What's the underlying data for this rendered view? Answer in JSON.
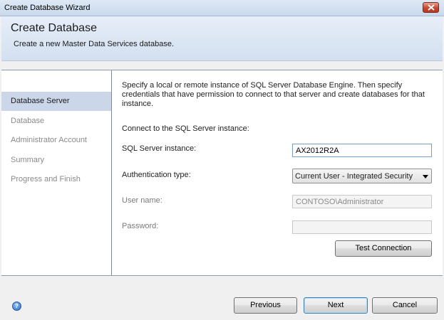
{
  "window": {
    "title": "Create Database Wizard"
  },
  "header": {
    "title": "Create Database",
    "subtitle": "Create a new Master Data Services database."
  },
  "nav": {
    "items": [
      {
        "label": "Database Server"
      },
      {
        "label": "Database"
      },
      {
        "label": "Administrator Account"
      },
      {
        "label": "Summary"
      },
      {
        "label": "Progress and Finish"
      }
    ],
    "active": "Database Server"
  },
  "content": {
    "intro": "Specify a local or remote instance of SQL Server Database Engine. Then specify credentials that have permission to connect to that server and create databases for that instance.",
    "section": "Connect to the SQL Server instance:",
    "instance_label": "SQL Server instance:",
    "instance_value": "AX2012R2A",
    "auth_label": "Authentication type:",
    "auth_value": "Current User - Integrated Security",
    "username_label": "User name:",
    "username_value": "CONTOSO\\Administrator",
    "password_label": "Password:",
    "password_value": "",
    "test_button": "Test Connection"
  },
  "footer": {
    "help_icon": "help-icon",
    "previous": "Previous",
    "next": "Next",
    "cancel": "Cancel"
  },
  "colors": {
    "active_nav": "#cbd7e8",
    "header_bg": "#dbe6f3",
    "close_button": "#c8462e"
  }
}
